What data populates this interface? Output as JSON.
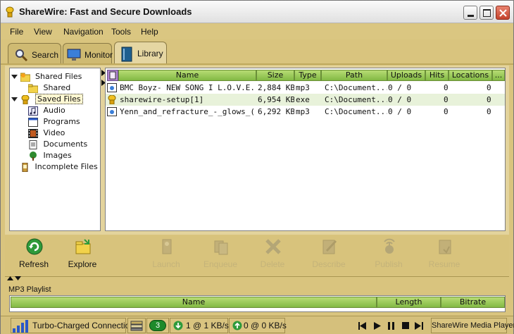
{
  "window": {
    "title": "ShareWire: Fast and Secure Downloads"
  },
  "menu": {
    "file": "File",
    "view": "View",
    "navigation": "Navigation",
    "tools": "Tools",
    "help": "Help"
  },
  "tabs": [
    {
      "label": "Search",
      "icon": "search-icon"
    },
    {
      "label": "Monitor",
      "icon": "monitor-icon"
    },
    {
      "label": "Library",
      "icon": "library-icon",
      "active": true
    }
  ],
  "tree": {
    "shared_files": "Shared Files",
    "shared": "Shared",
    "saved_files": "Saved Files",
    "audio": "Audio",
    "programs": "Programs",
    "video": "Video",
    "documents": "Documents",
    "images": "Images",
    "incomplete_files": "Incomplete Files"
  },
  "table": {
    "columns": {
      "name": "Name",
      "size": "Size",
      "type": "Type",
      "path": "Path",
      "uploads": "Uploads",
      "hits": "Hits",
      "locations": "Locations",
      "more": "..."
    },
    "rows": [
      {
        "name": "BMC Boyz- NEW SONG  I L.O.V.E...",
        "size": "2,884 KB",
        "type": "mp3",
        "path": "C:\\Document...",
        "uploads": "0 / 0",
        "hits": "0",
        "locations": "0"
      },
      {
        "name": "sharewire-setup[1]",
        "size": "6,954 KB",
        "type": "exe",
        "path": "C:\\Document...",
        "uploads": "0 / 0",
        "hits": "0",
        "locations": "0"
      },
      {
        "name": "Yenn_and_refracture_-_glows_(r...",
        "size": "6,292 KB",
        "type": "mp3",
        "path": "C:\\Document...",
        "uploads": "0 / 0",
        "hits": "0",
        "locations": "0"
      }
    ]
  },
  "toolbar": {
    "refresh": "Refresh",
    "explore": "Explore",
    "launch": "Launch",
    "enqueue": "Enqueue",
    "delete": "Delete",
    "describe": "Describe",
    "publish": "Publish",
    "resume": "Resume"
  },
  "playlist": {
    "label": "MP3 Playlist",
    "columns": {
      "name": "Name",
      "length": "Length",
      "bitrate": "Bitrate"
    }
  },
  "status": {
    "connection": "Turbo-Charged Connection",
    "badge": "3",
    "download": "1 @ 1 KB/s",
    "upload": "0 @ 0 KB/s",
    "media_player": "ShareWire Media Player"
  },
  "colors": {
    "frame": "#d9c47e",
    "header_green": "#82b944",
    "alt_row": "#e8f2da"
  }
}
